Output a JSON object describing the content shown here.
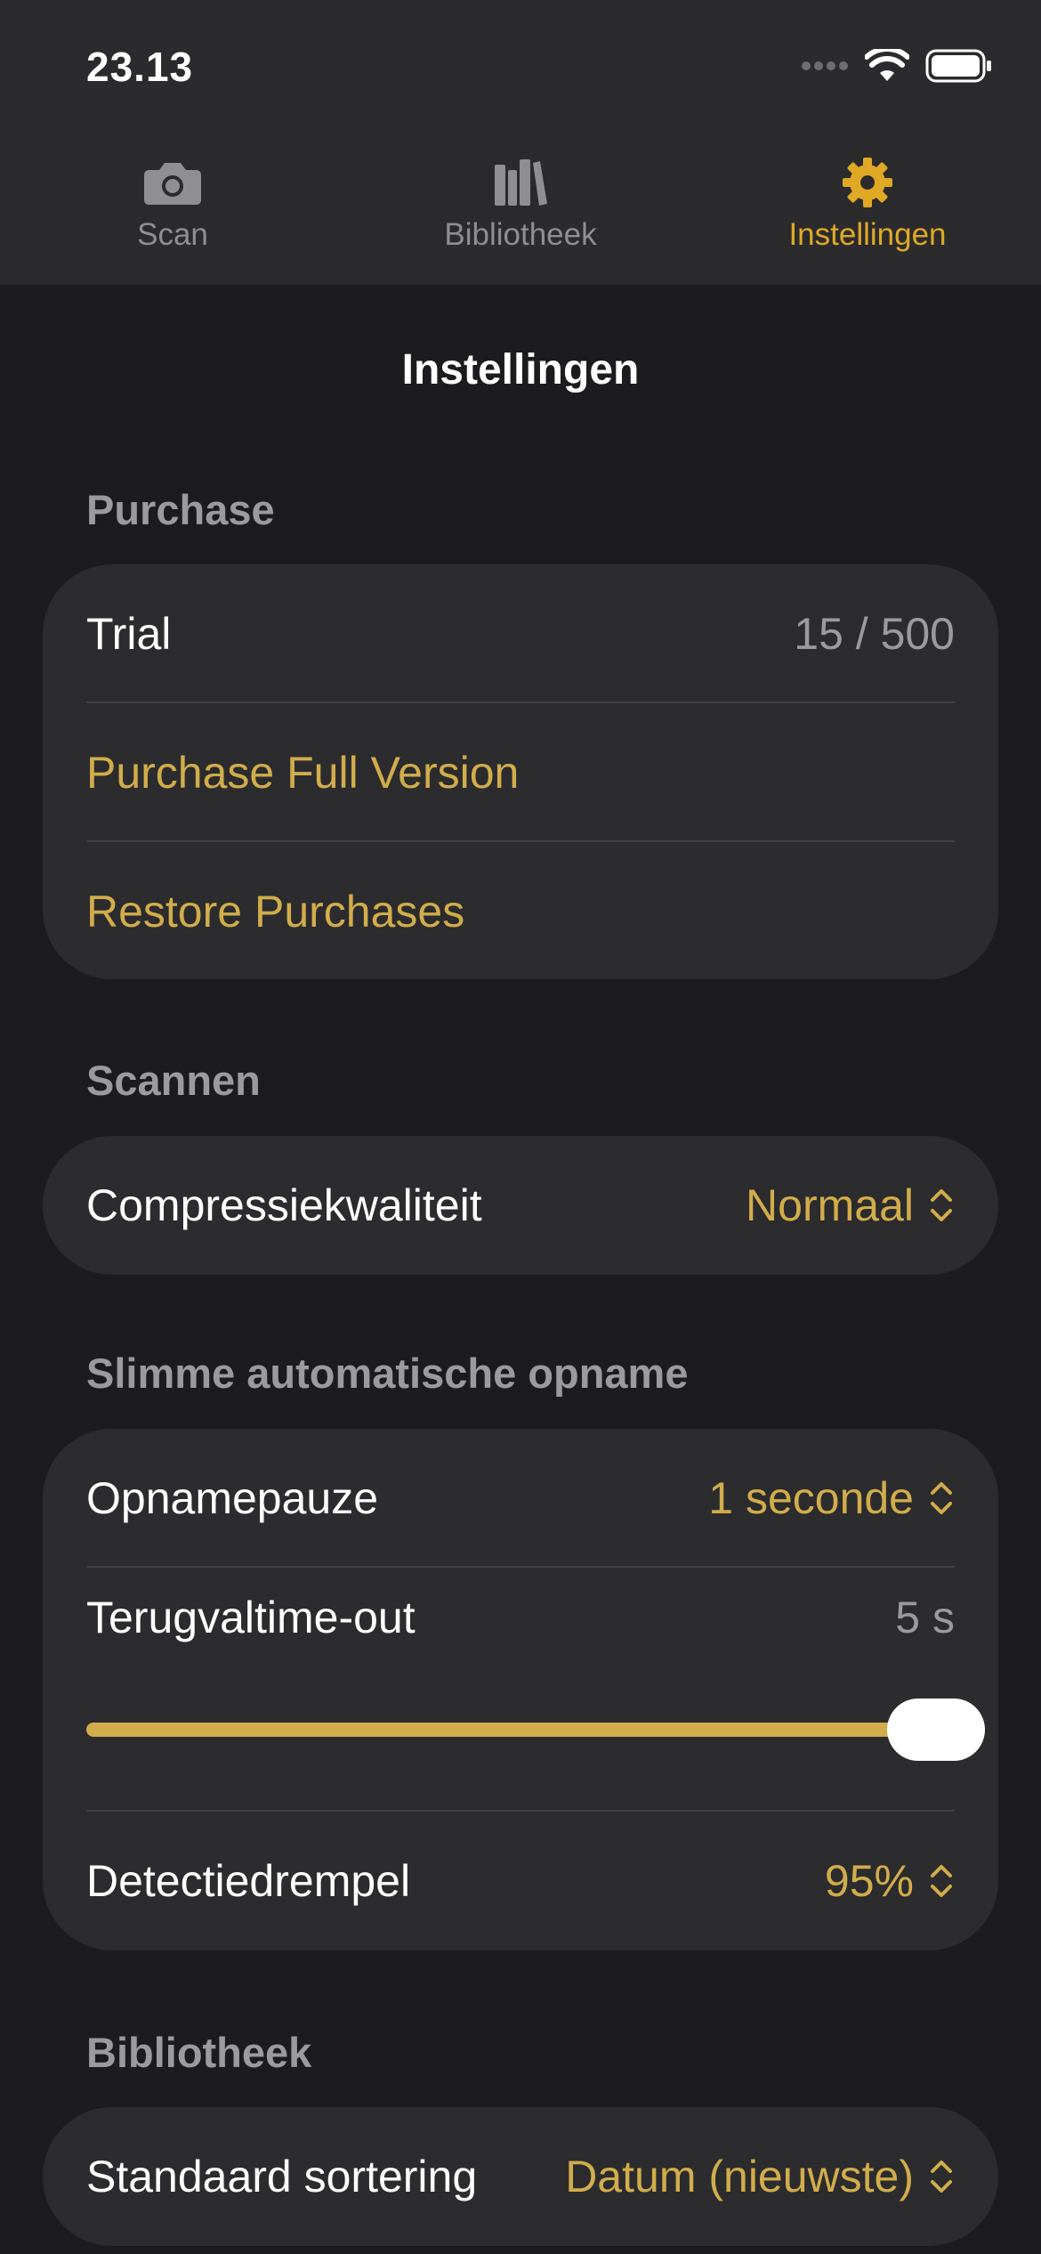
{
  "status_bar": {
    "time": "23.13"
  },
  "tabs": [
    {
      "label": "Scan",
      "icon": "camera-icon"
    },
    {
      "label": "Bibliotheek",
      "icon": "books-icon"
    },
    {
      "label": "Instellingen",
      "icon": "gear-icon",
      "active": true
    }
  ],
  "page_title": "Instellingen",
  "colors": {
    "accent": "#e0a925",
    "accent_text": "#d1ad4b",
    "background": "#1c1c1e",
    "card": "#2c2c2e"
  },
  "sections": {
    "purchase": {
      "header": "Purchase",
      "trial_label": "Trial",
      "trial_value": "15 / 500",
      "purchase_full": "Purchase Full Version",
      "restore": "Restore Purchases"
    },
    "scannen": {
      "header": "Scannen",
      "compression_label": "Compressiekwaliteit",
      "compression_value": "Normaal"
    },
    "smart": {
      "header": "Slimme automatische opname",
      "pause_label": "Opnamepauze",
      "pause_value": "1 seconde",
      "timeout_label": "Terugvaltime-out",
      "timeout_value": "5 s",
      "timeout_slider_fraction": 1.0,
      "threshold_label": "Detectiedrempel",
      "threshold_value": "95%"
    },
    "library": {
      "header": "Bibliotheek",
      "sort_label": "Standaard sortering",
      "sort_value": "Datum (nieuwste)"
    }
  }
}
